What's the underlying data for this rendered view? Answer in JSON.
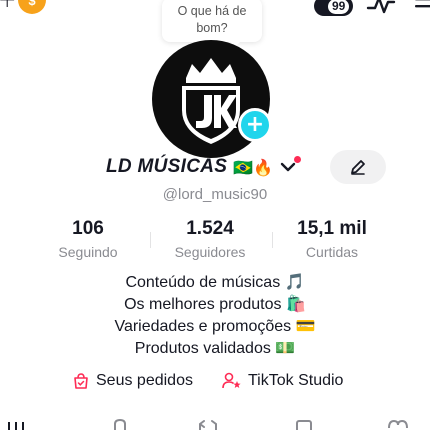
{
  "colors": {
    "accent": "#fe2c55",
    "plus_badge": "#20d5ec",
    "coin": "#f7a21b",
    "muted_text": "#8a8b91",
    "button_bg": "#f1f1f2"
  },
  "top_bar": {
    "plus_glyph": "+",
    "coin_icon": "coin-icon",
    "bubble_text": "O que há de bom?",
    "notification_count": "99",
    "activity_icon": "activity-icon",
    "menu_icon": "menu-icon"
  },
  "profile": {
    "avatar_initials": "JK",
    "display_name": "LD MÚSICAS",
    "name_emojis": "🇧🇷🔥",
    "handle": "@lord_music90",
    "edit_icon": "pencil-icon"
  },
  "stats": [
    {
      "value": "106",
      "label": "Seguindo"
    },
    {
      "value": "1.524",
      "label": "Seguidores"
    },
    {
      "value": "15,1 mil",
      "label": "Curtidas"
    }
  ],
  "bio": [
    "Conteúdo de músicas 🎵",
    "Os melhores produtos 🛍️",
    "Variedades e promoções 💳",
    "Produtos validados 💵"
  ],
  "links": {
    "orders": "Seus pedidos",
    "studio": "TikTok Studio"
  }
}
